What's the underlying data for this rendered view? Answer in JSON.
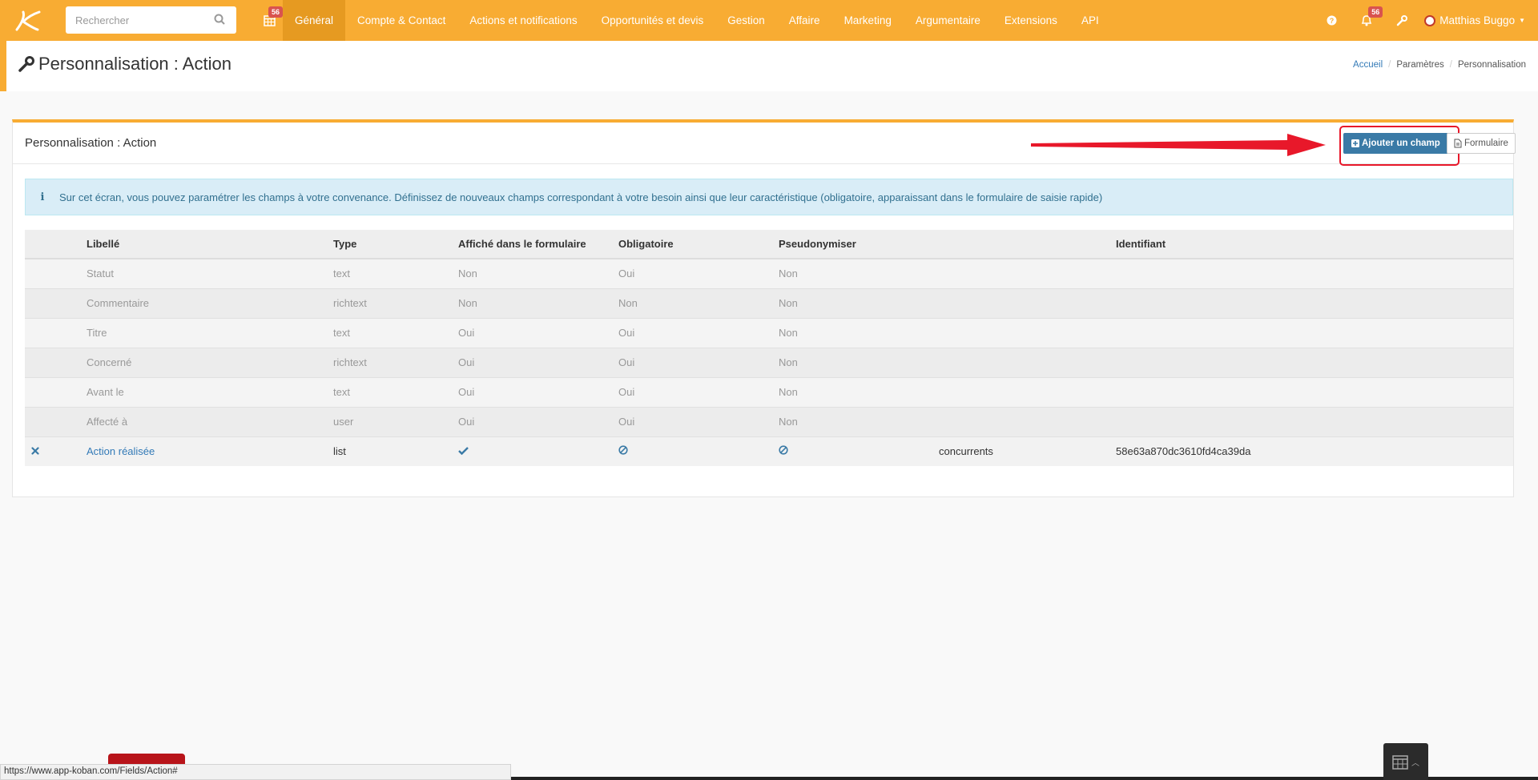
{
  "navbar": {
    "search_placeholder": "Rechercher",
    "calendar_badge": "56",
    "menu": [
      "Général",
      "Compte & Contact",
      "Actions et notifications",
      "Opportunités et devis",
      "Gestion",
      "Affaire",
      "Marketing",
      "Argumentaire",
      "Extensions",
      "API"
    ],
    "notifications_badge": "56",
    "user_name": "Matthias Buggo"
  },
  "header": {
    "title": "Personnalisation : Action",
    "breadcrumb": {
      "home": "Accueil",
      "settings": "Paramètres",
      "current": "Personnalisation"
    }
  },
  "panel": {
    "title": "Personnalisation : Action",
    "add_button": "Ajouter un champ",
    "form_button": "Formulaire",
    "info": "Sur cet écran, vous pouvez paramétrer les champs à votre convenance. Définissez de nouveaux champs correspondant à votre besoin ainsi que leur caractéristique (obligatoire, apparaissant dans le formulaire de saisie rapide)"
  },
  "table": {
    "headers": [
      "",
      "Libellé",
      "Type",
      "Affiché dans le formulaire",
      "Obligatoire",
      "Pseudonymiser",
      "",
      "Identifiant"
    ],
    "rows": [
      [
        "",
        "Statut",
        "text",
        "Non",
        "Oui",
        "Non",
        "",
        ""
      ],
      [
        "",
        "Commentaire",
        "richtext",
        "Non",
        "Non",
        "Non",
        "",
        ""
      ],
      [
        "",
        "Titre",
        "text",
        "Oui",
        "Oui",
        "Non",
        "",
        ""
      ],
      [
        "",
        "Concerné",
        "richtext",
        "Oui",
        "Oui",
        "Non",
        "",
        ""
      ],
      [
        "",
        "Avant le",
        "text",
        "Oui",
        "Oui",
        "Non",
        "",
        ""
      ],
      [
        "",
        "Affecté à",
        "user",
        "Oui",
        "Oui",
        "Non",
        "",
        ""
      ]
    ],
    "custom_row": {
      "label": "Action réalisée",
      "type": "list",
      "extra": "concurrents",
      "identifier": "58e63a870dc3610fd4ca39da"
    }
  },
  "statusbar": {
    "url": "https://www.app-koban.com/Fields/Action#"
  },
  "colors": {
    "accent": "#f8ac33",
    "primary_button": "#3a7aa6",
    "highlight": "#e8182a"
  }
}
